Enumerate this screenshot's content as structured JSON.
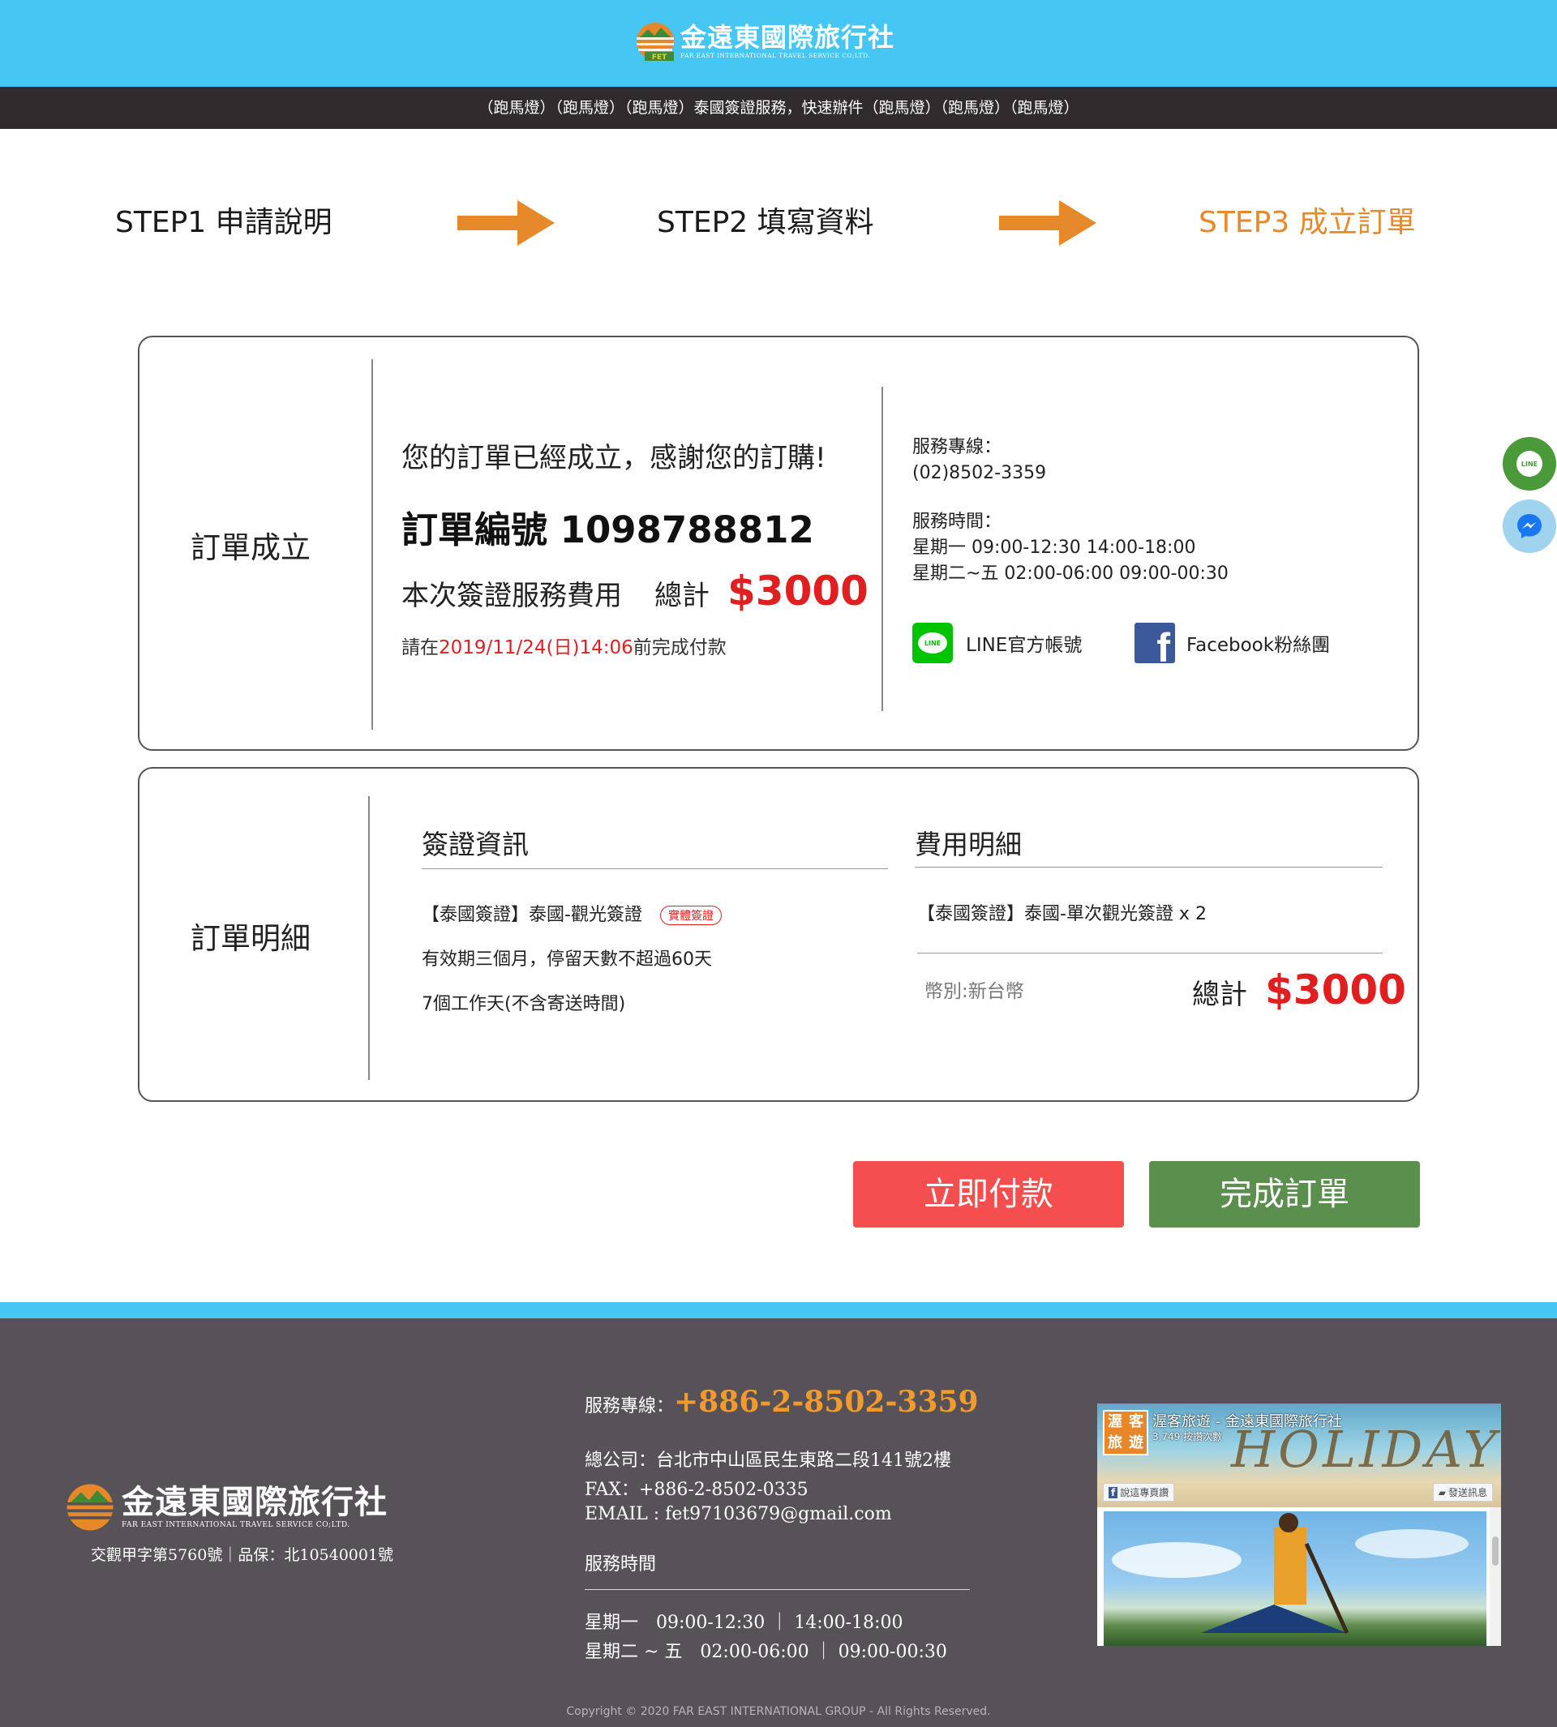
{
  "header": {
    "brand_name": "金遠東國際旅行社",
    "brand_sub": "FAR EAST INTERNATIONAL TRAVEL SERVICE CO;LTD.",
    "brand_badge": "FET",
    "marquee": "（跑馬燈）（跑馬燈）（跑馬燈）泰國簽證服務，快速辦件（跑馬燈）（跑馬燈）（跑馬燈）"
  },
  "steps": [
    {
      "label": "STEP1 申請說明",
      "active": false
    },
    {
      "label": "STEP2 填寫資料",
      "active": false
    },
    {
      "label": "STEP3 成立訂單",
      "active": true
    }
  ],
  "order": {
    "label": "訂單成立",
    "thanks": "您的訂單已經成立，感謝您的訂購!",
    "order_no": "訂單編號 1098788812",
    "fee_label": "本次簽證服務費用",
    "total_label": "總計",
    "total_amount": "$3000",
    "deadline_prefix": "請在",
    "deadline_date": "2019/11/24(日)14:06",
    "deadline_suffix": "前完成付款"
  },
  "service": {
    "hotline_label": "服務專線：",
    "hotline": "(02)8502-3359",
    "hours_label": "服務時間：",
    "hours_1": "星期一 09:00-12:30 14:00-18:00",
    "hours_2": "星期二~五 02:00-06:00 09:00-00:30",
    "line_label": "LINE官方帳號",
    "line_icon_text": "LINE",
    "fb_label": "Facebook粉絲團"
  },
  "detail": {
    "label": "訂單明細",
    "visa_title": "簽證資訊",
    "visa_item": "【泰國簽證】泰國-觀光簽證",
    "visa_badge": "實體簽證",
    "visa_validity": "有效期三個月，停留天數不超過60天",
    "visa_days": "7個工作天(不含寄送時間)",
    "fee_title": "費用明細",
    "fee_item": "【泰國簽證】泰國-單次觀光簽證 x 2",
    "currency": "幣別:新台幣",
    "total_label": "總計",
    "total_amount": "$3000"
  },
  "buttons": {
    "pay": "立即付款",
    "done": "完成訂單"
  },
  "floating": {
    "line": "LINE"
  },
  "footer": {
    "brand_name": "金遠東國際旅行社",
    "brand_sub": "FAR EAST INTERNATIONAL TRAVEL SERVICE CO;LTD.",
    "license": "交觀甲字第5760號｜品保：北10540001號",
    "hotline_label": "服務專線：",
    "hotline": "+886-2-8502-3359",
    "address": "總公司：台北市中山區民生東路二段141號2樓",
    "fax": "FAX：+886-2-8502-0335",
    "email": "EMAIL : fet97103679@gmail.com",
    "hours_title": "服務時間",
    "hours_1": "星期一　09:00-12:30 ｜ 14:00-18:00",
    "hours_2": "星期二 ~ 五　02:00-06:00 ｜ 09:00-00:30",
    "copyright": "Copyright © 2020 FAR EAST INTERNATIONAL GROUP - All Rights Reserved.",
    "fb_widget": {
      "page_name": "渥客旅遊 - 金遠東國際旅行社",
      "likes": "3,749 按讚次數",
      "thumb_chars": [
        "渥",
        "客",
        "旅",
        "遊"
      ],
      "cover_text": "HOLIDAYS",
      "like_button": "說這專頁讚",
      "message_button": "發送訊息"
    }
  },
  "colors": {
    "header_bg": "#45c6f3",
    "marquee_bg": "#302b2d",
    "step_active": "#e6892b",
    "price_red": "#e02020",
    "pay_button": "#f44e4e",
    "done_button": "#5a8f4e",
    "footer_bg": "#575258",
    "footer_phone": "#f39a2c"
  }
}
